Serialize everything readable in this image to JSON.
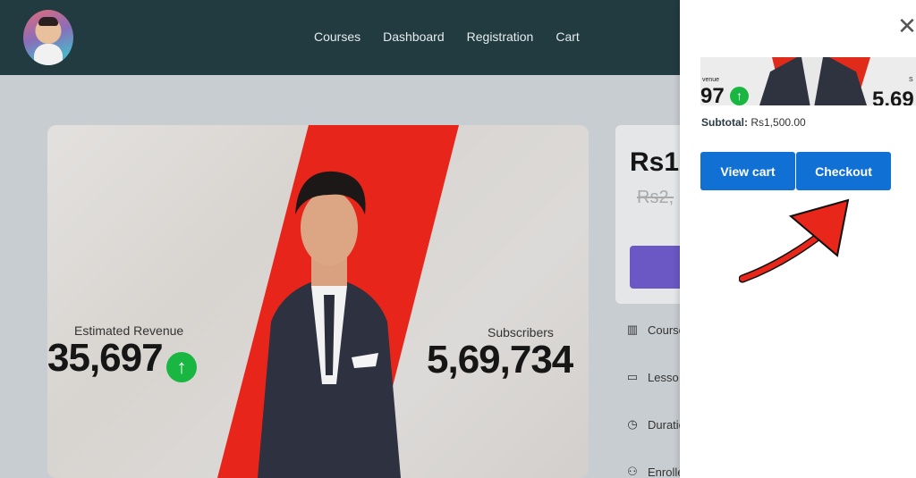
{
  "header": {
    "nav": [
      "Courses",
      "Dashboard",
      "Registration",
      "Cart"
    ]
  },
  "hero": {
    "stat_left_label": "Estimated Revenue",
    "stat_left_value": "35,697",
    "stat_right_label": "Subscribers",
    "stat_right_value": "5,69,734"
  },
  "sidebar": {
    "price": "Rs1,",
    "old_price": "Rs2,",
    "meta": [
      "Course",
      "Lesso",
      "Duratio",
      "Enrolle"
    ]
  },
  "cart": {
    "thumb_label_left": "venue",
    "thumb_value_left": "97",
    "thumb_label_right": "S",
    "thumb_value_right": "5,69",
    "subtotal_label": "Subtotal:",
    "subtotal_value": "Rs1,500.00",
    "view_cart": "View cart",
    "checkout": "Checkout",
    "close": "✕"
  },
  "colors": {
    "header": "#223b40",
    "button": "#1170d4",
    "accent_red": "#e02b1b",
    "up_green": "#19b742",
    "enroll_purple": "#6b58c4"
  }
}
